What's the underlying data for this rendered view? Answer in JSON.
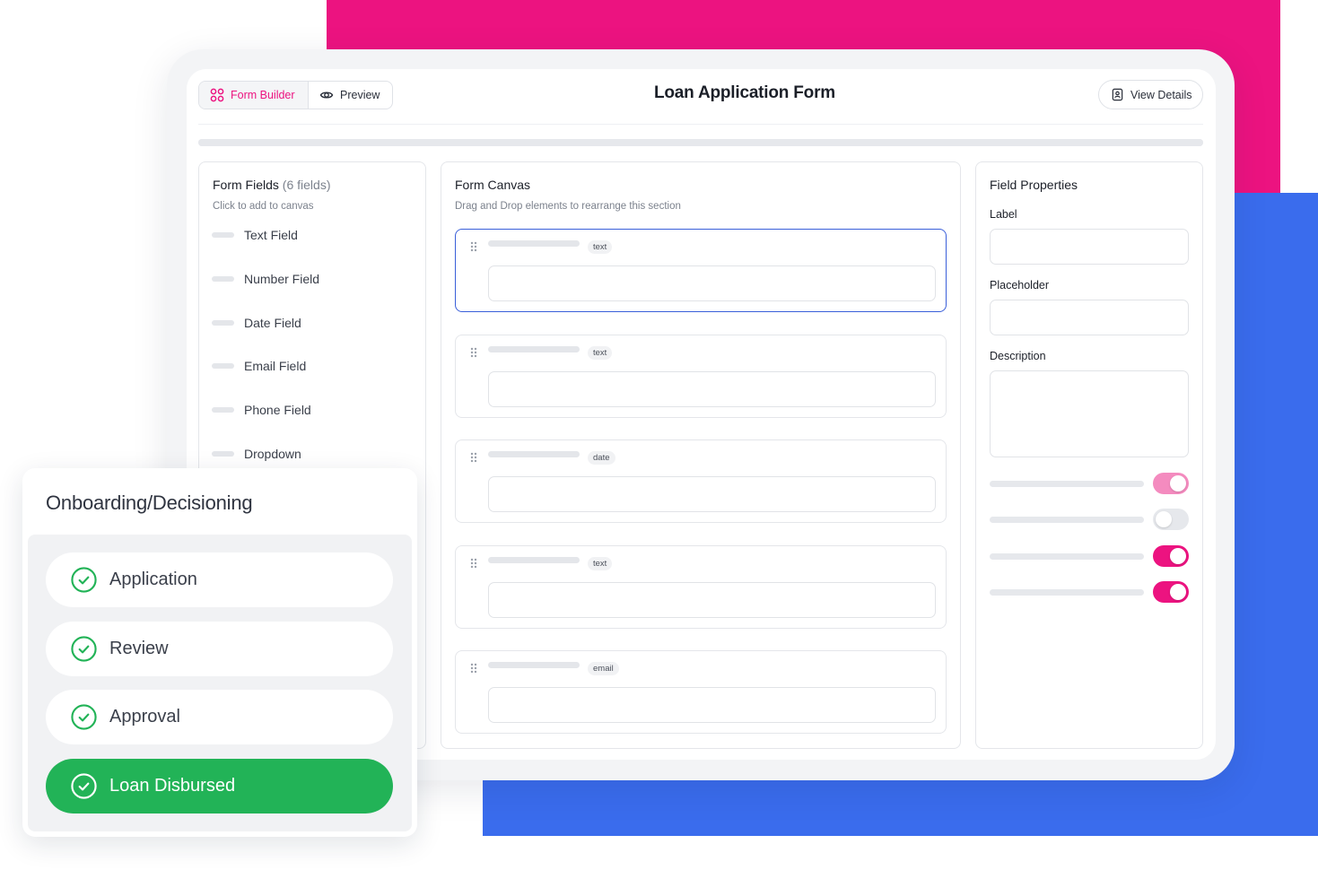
{
  "header": {
    "tabs": [
      {
        "label": "Form Builder",
        "icon": "grid-icon",
        "active": true
      },
      {
        "label": "Preview",
        "icon": "eye-icon",
        "active": false
      }
    ],
    "title": "Loan Application Form",
    "view_details_label": "View Details",
    "view_details_icon": "document-user-icon"
  },
  "form_fields": {
    "title": "Form Fields",
    "count": "(6 fields)",
    "subtitle": "Click to add to canvas",
    "items": [
      "Text Field",
      "Number Field",
      "Date Field",
      "Email Field",
      "Phone Field",
      "Dropdown"
    ]
  },
  "canvas": {
    "title": "Form Canvas",
    "subtitle": "Drag and Drop elements to rearrange this section",
    "fields": [
      {
        "type": "text",
        "selected": true
      },
      {
        "type": "text",
        "selected": false
      },
      {
        "type": "date",
        "selected": false
      },
      {
        "type": "text",
        "selected": false
      },
      {
        "type": "email",
        "selected": false
      }
    ]
  },
  "properties": {
    "title": "Field Properties",
    "label": "Label",
    "placeholder": "Placeholder",
    "description": "Description",
    "toggles": [
      {
        "on": true,
        "color": "#f48bbf"
      },
      {
        "on": false,
        "color": "#e6e8ec"
      },
      {
        "on": true,
        "color": "#ec1380"
      },
      {
        "on": true,
        "color": "#ec1380"
      }
    ]
  },
  "onboarding": {
    "title": "Onboarding/Decisioning",
    "steps": [
      {
        "label": "Application",
        "status": "complete"
      },
      {
        "label": "Review",
        "status": "complete"
      },
      {
        "label": "Approval",
        "status": "complete"
      },
      {
        "label": "Loan Disbursed",
        "status": "current"
      }
    ]
  },
  "colors": {
    "brand_pink": "#ec1380",
    "brand_blue": "#3a6ced",
    "success_green": "#22b357",
    "selection_blue": "#3a5fd9"
  }
}
